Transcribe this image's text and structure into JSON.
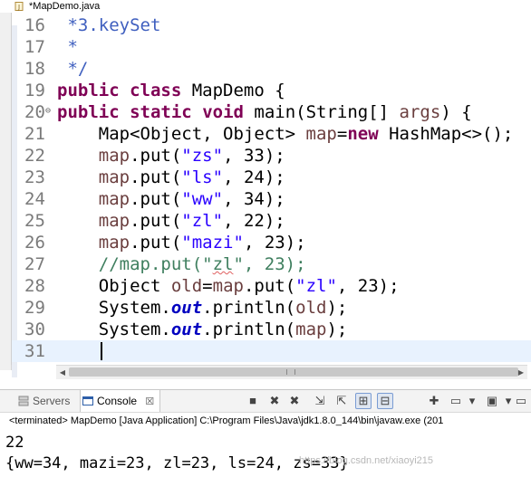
{
  "editor_tab": {
    "title": "*MapDemo.java",
    "close": "✕"
  },
  "lines": [
    {
      "num": "16",
      "parts": [
        {
          "t": " *3.keySet",
          "c": "doc"
        }
      ]
    },
    {
      "num": "17",
      "parts": [
        {
          "t": " *",
          "c": "doc"
        }
      ]
    },
    {
      "num": "18",
      "parts": [
        {
          "t": " */",
          "c": "doc"
        }
      ]
    },
    {
      "num": "19",
      "parts": [
        {
          "t": "public",
          "c": "kw"
        },
        {
          "t": " "
        },
        {
          "t": "class",
          "c": "kw"
        },
        {
          "t": " MapDemo {"
        }
      ]
    },
    {
      "num": "20",
      "fold": "⊖",
      "parts": [
        {
          "t": "public",
          "c": "kw"
        },
        {
          "t": " "
        },
        {
          "t": "static",
          "c": "kw"
        },
        {
          "t": " "
        },
        {
          "t": "void",
          "c": "kw"
        },
        {
          "t": " main(String[] "
        },
        {
          "t": "args",
          "c": "var"
        },
        {
          "t": ") {"
        }
      ]
    },
    {
      "num": "21",
      "parts": [
        {
          "t": "    Map<Object, Object> "
        },
        {
          "t": "map",
          "c": "var"
        },
        {
          "t": "="
        },
        {
          "t": "new",
          "c": "kw"
        },
        {
          "t": " HashMap<>();"
        }
      ]
    },
    {
      "num": "22",
      "parts": [
        {
          "t": "    "
        },
        {
          "t": "map",
          "c": "var"
        },
        {
          "t": ".put("
        },
        {
          "t": "\"zs\"",
          "c": "str"
        },
        {
          "t": ", 33);"
        }
      ]
    },
    {
      "num": "23",
      "parts": [
        {
          "t": "    "
        },
        {
          "t": "map",
          "c": "var"
        },
        {
          "t": ".put("
        },
        {
          "t": "\"ls\"",
          "c": "str"
        },
        {
          "t": ", 24);"
        }
      ]
    },
    {
      "num": "24",
      "parts": [
        {
          "t": "    "
        },
        {
          "t": "map",
          "c": "var"
        },
        {
          "t": ".put("
        },
        {
          "t": "\"ww\"",
          "c": "str"
        },
        {
          "t": ", 34);"
        }
      ]
    },
    {
      "num": "25",
      "parts": [
        {
          "t": "    "
        },
        {
          "t": "map",
          "c": "var"
        },
        {
          "t": ".put("
        },
        {
          "t": "\"zl\"",
          "c": "str"
        },
        {
          "t": ", 22);"
        }
      ]
    },
    {
      "num": "26",
      "parts": [
        {
          "t": "    "
        },
        {
          "t": "map",
          "c": "var"
        },
        {
          "t": ".put("
        },
        {
          "t": "\"mazi\"",
          "c": "str"
        },
        {
          "t": ", 23);"
        }
      ]
    },
    {
      "num": "27",
      "parts": [
        {
          "t": "    //map.put(\"",
          "c": "cm"
        },
        {
          "t": "zl",
          "c": "cm squig"
        },
        {
          "t": "\", 23);",
          "c": "cm"
        }
      ]
    },
    {
      "num": "28",
      "parts": [
        {
          "t": "    Object "
        },
        {
          "t": "old",
          "c": "var"
        },
        {
          "t": "="
        },
        {
          "t": "map",
          "c": "var"
        },
        {
          "t": ".put("
        },
        {
          "t": "\"zl\"",
          "c": "str"
        },
        {
          "t": ", 23);"
        }
      ]
    },
    {
      "num": "29",
      "parts": [
        {
          "t": "    System."
        },
        {
          "t": "out",
          "c": "fld"
        },
        {
          "t": ".println("
        },
        {
          "t": "old",
          "c": "var"
        },
        {
          "t": ");"
        }
      ]
    },
    {
      "num": "30",
      "parts": [
        {
          "t": "    System."
        },
        {
          "t": "out",
          "c": "fld"
        },
        {
          "t": ".println("
        },
        {
          "t": "map",
          "c": "var"
        },
        {
          "t": ");"
        }
      ]
    },
    {
      "num": "31",
      "current": true,
      "parts": [
        {
          "t": ""
        }
      ]
    }
  ],
  "console": {
    "tabs": [
      {
        "label": "Servers",
        "close": ""
      },
      {
        "label": "Console",
        "close": "☒"
      }
    ],
    "terminated": "<terminated> MapDemo [Java Application] C:\\Program Files\\Java\\jdk1.8.0_144\\bin\\javaw.exe (201",
    "output": [
      "22",
      "{ww=34, mazi=23, zl=23, ls=24, zs=33}"
    ],
    "watermark": "https://blog.csdn.net/xiaoyi215"
  },
  "toolbar_glyphs": [
    "■",
    "✖",
    "✖",
    "⇲",
    "⇱",
    "⊞",
    "⊟",
    "✚",
    "▭",
    "▾",
    "▣",
    "▾",
    "▭"
  ]
}
